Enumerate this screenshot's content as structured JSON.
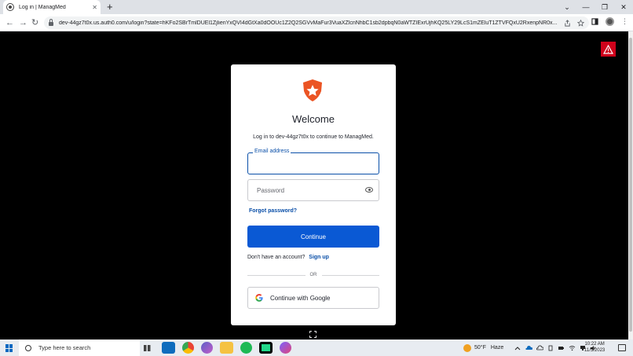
{
  "browser": {
    "tab_title": "Log in | ManagMed",
    "tab_close": "✕",
    "new_tab": "+",
    "window_controls": [
      "⌄",
      "—",
      "❐",
      "✕"
    ],
    "url": "dev-44gz7t0x.us.auth0.com/u/login?state=hKFo2SBrTmlDUEl1ZjlienYxQVI4dGtXa0dOOUc1Z2Q2SGVvMaFur3VuaXZlcnNhbC1sb2dpbqN0aWTZIExrUjhKQ25LY29LcS1mZEluT1ZTVFQxU2RxenpNR0x...",
    "nav": {
      "back": "←",
      "forward": "→",
      "reload": "↻"
    },
    "menu": "⋮"
  },
  "login": {
    "title": "Welcome",
    "subtitle": "Log in to dev-44gz7t0x to continue to ManagMed.",
    "email_label": "Email address",
    "email_value": "",
    "password_placeholder": "Password",
    "forgot_password": "Forgot password?",
    "continue_label": "Continue",
    "no_account_text": "Don't have an account?",
    "signup_link": "Sign up",
    "or_text": "OR",
    "google_label": "Continue with Google"
  },
  "taskbar": {
    "search_placeholder": "Type here to search",
    "weather_temp": "50°F",
    "weather_condition": "Haze",
    "time": "10:22 AM",
    "date": "11/5/2023"
  },
  "colors": {
    "accent": "#0a59d4",
    "link": "#0a4fa8",
    "auth0_orange": "#eb5424",
    "warning_red": "#d0021b"
  }
}
